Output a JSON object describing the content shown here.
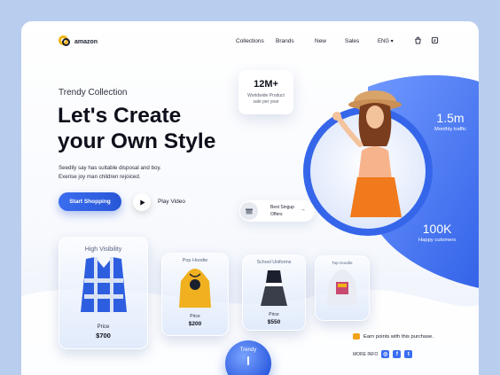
{
  "brand": {
    "name": "amazon"
  },
  "nav": {
    "items": [
      "Collections",
      "Brands",
      "New",
      "Sales"
    ],
    "lang": "ENG ▾",
    "icons": [
      "bag-icon",
      "cart-icon"
    ]
  },
  "hero": {
    "eyebrow": "Trendy Collection",
    "headline_line1": "Let's Create",
    "headline_line2": "your Own Style",
    "subtitle_line1": "Seedily say has suitable disposal and boy.",
    "subtitle_line2": "Exerise joy man children rejoiced.",
    "cta_label": "Start Shopping",
    "video_label": "Play Video"
  },
  "stats": {
    "products": {
      "value": "12M+",
      "label_line1": "Worldwide Product",
      "label_line2": "sale per year"
    },
    "traffic": {
      "value": "1.5m",
      "label": "Monthly traffic"
    },
    "customers": {
      "value": "100K",
      "label": "Happy cutomers"
    }
  },
  "offer": {
    "line1": "Best Singup",
    "line2": "Offers",
    "arrow": "→"
  },
  "products": [
    {
      "title": "High Visibility",
      "price_label": "Price",
      "price": "$700"
    },
    {
      "title": "Pop Hoodie",
      "price_label": "Price",
      "price": "$200"
    },
    {
      "title": "School Uniforms",
      "price_label": "Price",
      "price": "$550"
    },
    {
      "title": "Top Hoodie",
      "price_label": "",
      "price": ""
    }
  ],
  "footer": {
    "earn": "Earn points with this purchase.",
    "more_info": "MORE INFO",
    "social": [
      "instagram-icon",
      "facebook-icon",
      "twitter-icon"
    ]
  },
  "trendy": {
    "label": "Trendy"
  },
  "colors": {
    "accent": "#2e5ee0",
    "brand_yellow": "#f2b511",
    "background": "#b9cdee"
  }
}
